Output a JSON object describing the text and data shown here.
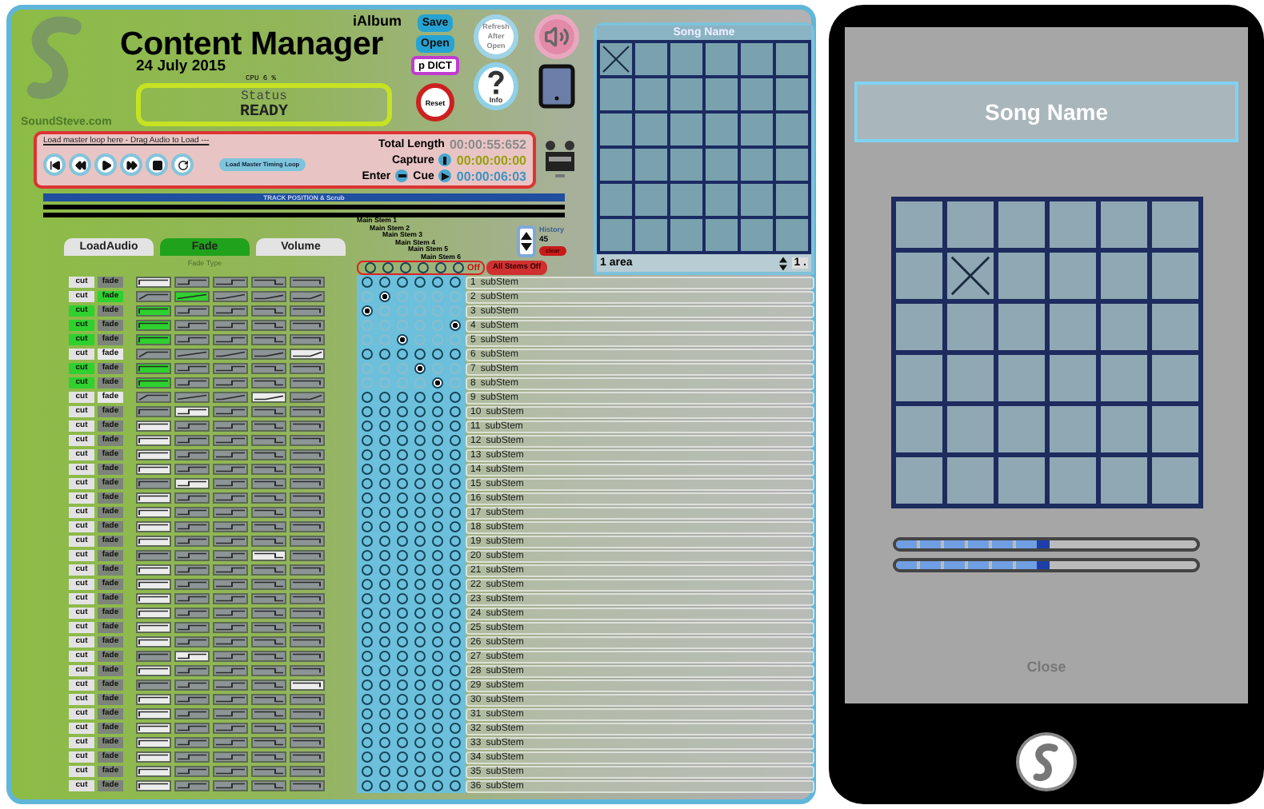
{
  "header": {
    "logo_caption": "SoundSteve.com",
    "subtitle": "iAlbum",
    "title": "Content Manager",
    "date": "24 July 2015",
    "cpu": "CPU 6 %",
    "status_label": "Status",
    "status_value": "READY"
  },
  "toolbar": {
    "save": "Save",
    "open": "Open",
    "dict": "p DICT",
    "reset": "Reset",
    "refresh": "Refresh After Open",
    "info": "Info"
  },
  "transport": {
    "drop_hint": "Load master loop here - Drag Audio to Load ---",
    "timing_button": "Load Master Timing Loop",
    "total_label": "Total Length",
    "total": "00:00:55:652",
    "capture_label": "Capture",
    "capture": "00:00:00:00",
    "enter_label": "Enter",
    "cue_label": "Cue",
    "cue": "00:00:06:03",
    "track_label": "TRACK POSITION & Scrub"
  },
  "tabs": [
    {
      "label": "LoadAudio",
      "selected": false
    },
    {
      "label": "Fade",
      "selected": true
    },
    {
      "label": "Volume",
      "selected": false
    }
  ],
  "fade_type_label": "Fade Type",
  "stems": {
    "labels": [
      "Main Stem 1",
      "Main Stem 2",
      "Main Stem 3",
      "Main Stem 4",
      "Main Stem 5",
      "Main Stem 6"
    ],
    "off_states": [
      false,
      false,
      false,
      false,
      false,
      false
    ],
    "off_label": "Off",
    "all_off": "All Stems Off"
  },
  "history": {
    "label": "History",
    "count": "45",
    "clear": "clear"
  },
  "song_panel": {
    "title": "Song Name",
    "area": "1 area",
    "area_count": "1 .",
    "grid": [
      [
        true,
        false,
        false,
        false,
        false,
        false
      ],
      [
        false,
        false,
        false,
        false,
        false,
        false
      ],
      [
        false,
        false,
        false,
        false,
        false,
        false
      ],
      [
        false,
        false,
        false,
        false,
        false,
        false
      ],
      [
        false,
        false,
        false,
        false,
        false,
        false
      ],
      [
        false,
        false,
        false,
        false,
        false,
        false
      ]
    ]
  },
  "rows": [
    {
      "number": "1",
      "name": "subStem",
      "cut": "cut",
      "fade": "fade",
      "cut_on": false,
      "fade_on": false,
      "ramp": false,
      "curves": [
        true,
        false,
        false,
        false,
        false
      ],
      "stems": [
        false,
        false,
        false,
        false,
        false,
        false
      ]
    },
    {
      "number": "2",
      "name": "subStem",
      "cut": "cut",
      "fade": "fade",
      "cut_on": false,
      "fade_on": true,
      "ramp": true,
      "curves": [
        false,
        true,
        false,
        false,
        false
      ],
      "stems": [
        false,
        true,
        false,
        false,
        false,
        false
      ]
    },
    {
      "number": "3",
      "name": "subStem",
      "cut": "cut",
      "fade": "fade",
      "cut_on": true,
      "fade_on": false,
      "ramp": false,
      "curves": [
        true,
        false,
        false,
        false,
        false
      ],
      "stems": [
        true,
        false,
        false,
        false,
        false,
        false
      ]
    },
    {
      "number": "4",
      "name": "subStem",
      "cut": "cut",
      "fade": "fade",
      "cut_on": true,
      "fade_on": false,
      "ramp": false,
      "curves": [
        true,
        false,
        false,
        false,
        false
      ],
      "stems": [
        false,
        false,
        false,
        false,
        false,
        true
      ]
    },
    {
      "number": "5",
      "name": "subStem",
      "cut": "cut",
      "fade": "fade",
      "cut_on": true,
      "fade_on": false,
      "ramp": false,
      "curves": [
        true,
        false,
        false,
        false,
        false
      ],
      "stems": [
        false,
        false,
        true,
        false,
        false,
        false
      ]
    },
    {
      "number": "6",
      "name": "subStem",
      "cut": "cut",
      "fade": "fade",
      "cut_on": false,
      "fade_on": false,
      "ramp": true,
      "curves": [
        false,
        false,
        false,
        false,
        true
      ],
      "stems": [
        false,
        false,
        false,
        false,
        false,
        false
      ]
    },
    {
      "number": "7",
      "name": "subStem",
      "cut": "cut",
      "fade": "fade",
      "cut_on": true,
      "fade_on": false,
      "ramp": false,
      "curves": [
        true,
        false,
        false,
        false,
        false
      ],
      "stems": [
        false,
        false,
        false,
        true,
        false,
        false
      ]
    },
    {
      "number": "8",
      "name": "subStem",
      "cut": "cut",
      "fade": "fade",
      "cut_on": true,
      "fade_on": false,
      "ramp": false,
      "curves": [
        true,
        false,
        false,
        false,
        false
      ],
      "stems": [
        false,
        false,
        false,
        false,
        true,
        false
      ]
    },
    {
      "number": "9",
      "name": "subStem",
      "cut": "cut",
      "fade": "fade",
      "cut_on": false,
      "fade_on": false,
      "ramp": true,
      "curves": [
        false,
        false,
        false,
        true,
        false
      ],
      "stems": [
        false,
        false,
        false,
        false,
        false,
        false
      ]
    },
    {
      "number": "10",
      "name": "subStem",
      "cut": "cut",
      "fade": "fade",
      "cut_on": false,
      "fade_on": false,
      "ramp": false,
      "curves": [
        false,
        true,
        false,
        false,
        false
      ],
      "stems": [
        false,
        false,
        false,
        false,
        false,
        false
      ]
    },
    {
      "number": "11",
      "name": "subStem",
      "cut": "cut",
      "fade": "fade",
      "cut_on": false,
      "fade_on": false,
      "ramp": false,
      "curves": [
        true,
        false,
        false,
        false,
        false
      ],
      "stems": [
        false,
        false,
        false,
        false,
        false,
        false
      ]
    },
    {
      "number": "12",
      "name": "subStem",
      "cut": "cut",
      "fade": "fade",
      "cut_on": false,
      "fade_on": false,
      "ramp": false,
      "curves": [
        true,
        false,
        false,
        false,
        false
      ],
      "stems": [
        false,
        false,
        false,
        false,
        false,
        false
      ]
    },
    {
      "number": "13",
      "name": "subStem",
      "cut": "cut",
      "fade": "fade",
      "cut_on": false,
      "fade_on": false,
      "ramp": false,
      "curves": [
        true,
        false,
        false,
        false,
        false
      ],
      "stems": [
        false,
        false,
        false,
        false,
        false,
        false
      ]
    },
    {
      "number": "14",
      "name": "subStem",
      "cut": "cut",
      "fade": "fade",
      "cut_on": false,
      "fade_on": false,
      "ramp": false,
      "curves": [
        true,
        false,
        false,
        false,
        false
      ],
      "stems": [
        false,
        false,
        false,
        false,
        false,
        false
      ]
    },
    {
      "number": "15",
      "name": "subStem",
      "cut": "cut",
      "fade": "fade",
      "cut_on": false,
      "fade_on": false,
      "ramp": false,
      "curves": [
        false,
        true,
        false,
        false,
        false
      ],
      "stems": [
        false,
        false,
        false,
        false,
        false,
        false
      ]
    },
    {
      "number": "16",
      "name": "subStem",
      "cut": "cut",
      "fade": "fade",
      "cut_on": false,
      "fade_on": false,
      "ramp": false,
      "curves": [
        true,
        false,
        false,
        false,
        false
      ],
      "stems": [
        false,
        false,
        false,
        false,
        false,
        false
      ]
    },
    {
      "number": "17",
      "name": "subStem",
      "cut": "cut",
      "fade": "fade",
      "cut_on": false,
      "fade_on": false,
      "ramp": false,
      "curves": [
        true,
        false,
        false,
        false,
        false
      ],
      "stems": [
        false,
        false,
        false,
        false,
        false,
        false
      ]
    },
    {
      "number": "18",
      "name": "subStem",
      "cut": "cut",
      "fade": "fade",
      "cut_on": false,
      "fade_on": false,
      "ramp": false,
      "curves": [
        true,
        false,
        false,
        false,
        false
      ],
      "stems": [
        false,
        false,
        false,
        false,
        false,
        false
      ]
    },
    {
      "number": "19",
      "name": "subStem",
      "cut": "cut",
      "fade": "fade",
      "cut_on": false,
      "fade_on": false,
      "ramp": false,
      "curves": [
        true,
        false,
        false,
        false,
        false
      ],
      "stems": [
        false,
        false,
        false,
        false,
        false,
        false
      ]
    },
    {
      "number": "20",
      "name": "subStem",
      "cut": "cut",
      "fade": "fade",
      "cut_on": false,
      "fade_on": false,
      "ramp": false,
      "curves": [
        false,
        false,
        false,
        true,
        false
      ],
      "stems": [
        false,
        false,
        false,
        false,
        false,
        false
      ]
    },
    {
      "number": "21",
      "name": "subStem",
      "cut": "cut",
      "fade": "fade",
      "cut_on": false,
      "fade_on": false,
      "ramp": false,
      "curves": [
        true,
        false,
        false,
        false,
        false
      ],
      "stems": [
        false,
        false,
        false,
        false,
        false,
        false
      ]
    },
    {
      "number": "22",
      "name": "subStem",
      "cut": "cut",
      "fade": "fade",
      "cut_on": false,
      "fade_on": false,
      "ramp": false,
      "curves": [
        true,
        false,
        false,
        false,
        false
      ],
      "stems": [
        false,
        false,
        false,
        false,
        false,
        false
      ]
    },
    {
      "number": "23",
      "name": "subStem",
      "cut": "cut",
      "fade": "fade",
      "cut_on": false,
      "fade_on": false,
      "ramp": false,
      "curves": [
        true,
        false,
        false,
        false,
        false
      ],
      "stems": [
        false,
        false,
        false,
        false,
        false,
        false
      ]
    },
    {
      "number": "24",
      "name": "subStem",
      "cut": "cut",
      "fade": "fade",
      "cut_on": false,
      "fade_on": false,
      "ramp": false,
      "curves": [
        true,
        false,
        false,
        false,
        false
      ],
      "stems": [
        false,
        false,
        false,
        false,
        false,
        false
      ]
    },
    {
      "number": "25",
      "name": "subStem",
      "cut": "cut",
      "fade": "fade",
      "cut_on": false,
      "fade_on": false,
      "ramp": false,
      "curves": [
        true,
        false,
        false,
        false,
        false
      ],
      "stems": [
        false,
        false,
        false,
        false,
        false,
        false
      ]
    },
    {
      "number": "26",
      "name": "subStem",
      "cut": "cut",
      "fade": "fade",
      "cut_on": false,
      "fade_on": false,
      "ramp": false,
      "curves": [
        true,
        false,
        false,
        false,
        false
      ],
      "stems": [
        false,
        false,
        false,
        false,
        false,
        false
      ]
    },
    {
      "number": "27",
      "name": "subStem",
      "cut": "cut",
      "fade": "fade",
      "cut_on": false,
      "fade_on": false,
      "ramp": false,
      "curves": [
        false,
        true,
        false,
        false,
        false
      ],
      "stems": [
        false,
        false,
        false,
        false,
        false,
        false
      ]
    },
    {
      "number": "28",
      "name": "subStem",
      "cut": "cut",
      "fade": "fade",
      "cut_on": false,
      "fade_on": false,
      "ramp": false,
      "curves": [
        true,
        false,
        false,
        false,
        false
      ],
      "stems": [
        false,
        false,
        false,
        false,
        false,
        false
      ]
    },
    {
      "number": "29",
      "name": "subStem",
      "cut": "cut",
      "fade": "fade",
      "cut_on": false,
      "fade_on": false,
      "ramp": false,
      "curves": [
        false,
        false,
        false,
        false,
        true
      ],
      "stems": [
        false,
        false,
        false,
        false,
        false,
        false
      ]
    },
    {
      "number": "30",
      "name": "subStem",
      "cut": "cut",
      "fade": "fade",
      "cut_on": false,
      "fade_on": false,
      "ramp": false,
      "curves": [
        true,
        false,
        false,
        false,
        false
      ],
      "stems": [
        false,
        false,
        false,
        false,
        false,
        false
      ]
    },
    {
      "number": "31",
      "name": "subStem",
      "cut": "cut",
      "fade": "fade",
      "cut_on": false,
      "fade_on": false,
      "ramp": false,
      "curves": [
        true,
        false,
        false,
        false,
        false
      ],
      "stems": [
        false,
        false,
        false,
        false,
        false,
        false
      ]
    },
    {
      "number": "32",
      "name": "subStem",
      "cut": "cut",
      "fade": "fade",
      "cut_on": false,
      "fade_on": false,
      "ramp": false,
      "curves": [
        true,
        false,
        false,
        false,
        false
      ],
      "stems": [
        false,
        false,
        false,
        false,
        false,
        false
      ]
    },
    {
      "number": "33",
      "name": "subStem",
      "cut": "cut",
      "fade": "fade",
      "cut_on": false,
      "fade_on": false,
      "ramp": false,
      "curves": [
        true,
        false,
        false,
        false,
        false
      ],
      "stems": [
        false,
        false,
        false,
        false,
        false,
        false
      ]
    },
    {
      "number": "34",
      "name": "subStem",
      "cut": "cut",
      "fade": "fade",
      "cut_on": false,
      "fade_on": false,
      "ramp": false,
      "curves": [
        true,
        false,
        false,
        false,
        false
      ],
      "stems": [
        false,
        false,
        false,
        false,
        false,
        false
      ]
    },
    {
      "number": "35",
      "name": "subStem",
      "cut": "cut",
      "fade": "fade",
      "cut_on": false,
      "fade_on": false,
      "ramp": false,
      "curves": [
        true,
        false,
        false,
        false,
        false
      ],
      "stems": [
        false,
        false,
        false,
        false,
        false,
        false
      ]
    },
    {
      "number": "36",
      "name": "subStem",
      "cut": "cut",
      "fade": "fade",
      "cut_on": false,
      "fade_on": false,
      "ramp": false,
      "curves": [
        true,
        false,
        false,
        false,
        false
      ],
      "stems": [
        false,
        false,
        false,
        false,
        false,
        false
      ]
    }
  ],
  "phone": {
    "title": "Song Name",
    "close": "Close",
    "grid": [
      [
        false,
        false,
        false,
        false,
        false,
        false
      ],
      [
        false,
        true,
        false,
        false,
        false,
        false
      ],
      [
        false,
        false,
        false,
        false,
        false,
        false
      ],
      [
        false,
        false,
        false,
        false,
        false,
        false
      ],
      [
        false,
        false,
        false,
        false,
        false,
        false
      ],
      [
        false,
        false,
        false,
        false,
        false,
        false
      ]
    ],
    "meters": [
      {
        "level": 0.51
      },
      {
        "level": 0.51
      }
    ]
  }
}
